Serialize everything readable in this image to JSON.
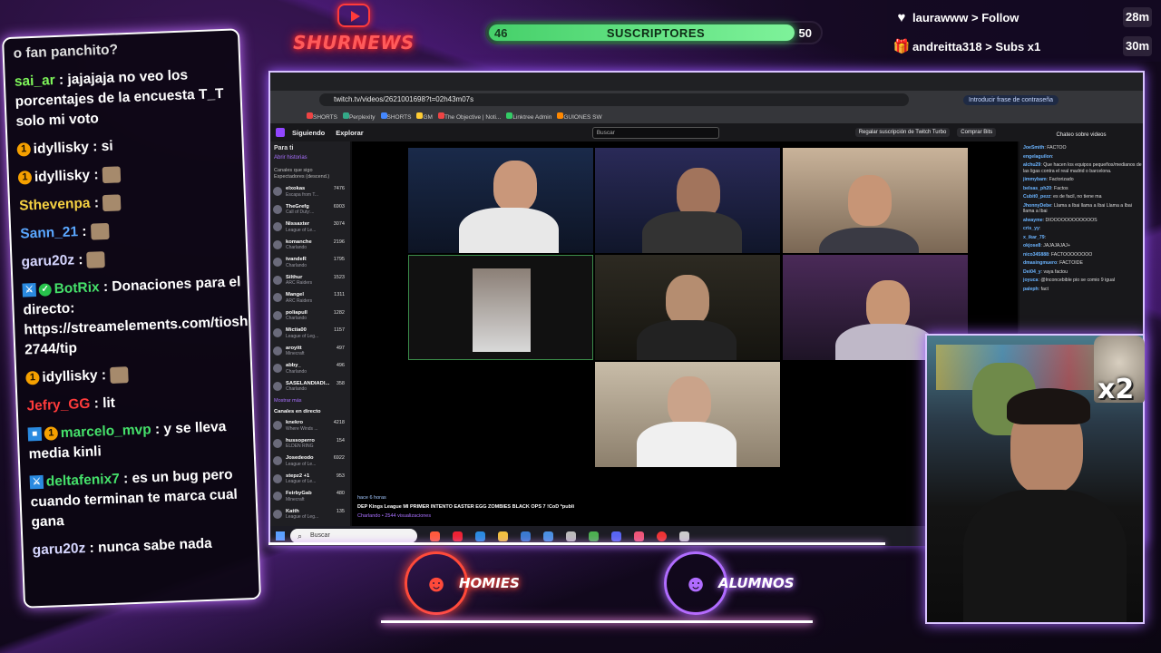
{
  "overlay": {
    "logo_text": "SHURNEWS",
    "subs": {
      "current": "46",
      "label": "SUSCRIPTORES",
      "goal": "50",
      "progress": 0.92
    },
    "alerts": [
      {
        "icon": "heart-icon",
        "text": "laurawww > Follow",
        "time": "28m"
      },
      {
        "icon": "gift-icon",
        "text": "andreitta318 > Subs x1",
        "time": "30m"
      }
    ],
    "teams": [
      {
        "name": "HOMIES",
        "color": "#ff4a3a"
      },
      {
        "name": "ALUMNOS",
        "color": "#b06cff"
      }
    ],
    "cam_badge": "x2"
  },
  "chat": {
    "top_text": "o fan panchito?",
    "messages": [
      {
        "user": "sai_ar",
        "color": "#7ef55a",
        "text": " : jajajaja no veo los porcentajes de la encuesta T_T solo mi voto",
        "badges": []
      },
      {
        "user": "idyllisky",
        "color": "#ffffff",
        "text": " : si",
        "badges": [
          "sub"
        ]
      },
      {
        "user": "idyllisky",
        "color": "#ffffff",
        "text": " : ",
        "badges": [
          "sub"
        ],
        "emote": true
      },
      {
        "user": "Sthevenpa",
        "color": "#f5d142",
        "text": " : ",
        "badges": [],
        "emote": true
      },
      {
        "user": "Sann_21",
        "color": "#5aa7ff",
        "text": " : ",
        "badges": [],
        "emote": true
      },
      {
        "user": "garu20z",
        "color": "#d6d6ff",
        "text": " : ",
        "badges": [],
        "emote": true
      },
      {
        "user": "BotRix",
        "color": "#45e06a",
        "text": " : Donaciones para el directo: https://streamelements.com/tioshur-2744/tip",
        "badges": [
          "mod",
          "verified"
        ]
      },
      {
        "user": "idyllisky",
        "color": "#ffffff",
        "text": " : ",
        "badges": [
          "sub"
        ],
        "emote": true
      },
      {
        "user": "Jefry_GG",
        "color": "#ff3b3b",
        "text": " : lit",
        "badges": []
      },
      {
        "user": "marcelo_mvp",
        "color": "#45e06a",
        "text": " : y se lleva media kinli",
        "badges": [
          "cube",
          "sub"
        ]
      },
      {
        "user": "deltafenix7",
        "color": "#45e06a",
        "text": " : es un bug pero cuando terminan te marca cual gana",
        "badges": [
          "mod"
        ]
      },
      {
        "user": "garu20z",
        "color": "#d6d6ff",
        "text": " : nunca sabe nada",
        "badges": []
      }
    ]
  },
  "browser": {
    "url": "twitch.tv/videos/2621001698?t=02h43m07s",
    "password_hint": "Introducir frase de contraseña",
    "bookmarks": [
      "SHORTS",
      "Perplexity",
      "SHORTS",
      "GM",
      "The Objective | Noti...",
      "Linktree Admin",
      "GUIONES SW"
    ],
    "twitch": {
      "nav": [
        "Siguiendo",
        "Explorar"
      ],
      "search_placeholder": "Buscar",
      "turbo": "Regalar suscripción de Twitch Turbo",
      "bits": "Comprar Bits",
      "sidebar_title": "Para ti",
      "open_history": "Abrir historias",
      "followed_title": "Canales que sigo",
      "followed_sub": "Espectadores (descend.)",
      "channels": [
        {
          "name": "elxokas",
          "game": "Escapa from T...",
          "viewers": "7476"
        },
        {
          "name": "TheGrefg",
          "game": "Call of Duty:...",
          "viewers": "6903"
        },
        {
          "name": "Nissaxter",
          "game": "League of Le...",
          "viewers": "3074"
        },
        {
          "name": "komanche",
          "game": "Charlando",
          "viewers": "2196"
        },
        {
          "name": "tvandeR",
          "game": "Charlando",
          "viewers": "1795"
        },
        {
          "name": "Silthur",
          "game": "ARC Raiders",
          "viewers": "1523"
        },
        {
          "name": "Mangel",
          "game": "ARC Raiders",
          "viewers": "1311"
        },
        {
          "name": "poliapull",
          "game": "Charlando",
          "viewers": "1282"
        },
        {
          "name": "Mictia00",
          "game": "League of Leg...",
          "viewers": "1157"
        },
        {
          "name": "aroyitt",
          "game": "Minecraft",
          "viewers": "497"
        },
        {
          "name": "abby_",
          "game": "Charlando",
          "viewers": "496"
        },
        {
          "name": "SASELANDIADI...",
          "game": "Charlando",
          "viewers": "358"
        }
      ],
      "show_more": "Mostrar más",
      "live_title": "Canales en directo",
      "live_channels": [
        {
          "name": "knekro",
          "game": "Where Winds ...",
          "viewers": "4218"
        },
        {
          "name": "hussoperro",
          "game": "ELDEN RING",
          "viewers": "154"
        },
        {
          "name": "Josedeodo",
          "game": "League of Le...",
          "viewers": "6922"
        },
        {
          "name": "stepz2 +1",
          "game": "League of Le...",
          "viewers": "953"
        },
        {
          "name": "FeirbyGab",
          "game": "Minecraft",
          "viewers": "480"
        },
        {
          "name": "Katth",
          "game": "League of Leg...",
          "viewers": "135"
        }
      ],
      "video_time": "hace 6 horas",
      "video_title": "DEP Kings League MI PRIMER INTENTO EASTER EGG ZOMBIES BLACK OPS 7 !CoD *publi",
      "video_meta": "Charlando • 2544 visualizaciones",
      "chat_header": "Chateo sobre videos",
      "chat_lines": [
        {
          "user": "JoeSmith",
          "text": "FACTOO"
        },
        {
          "user": "engelaguilon",
          "text": ""
        },
        {
          "user": "alchu29",
          "text": "Que hacen los equipos pequeños/medianos de las ligas contra el real madrid o barcelona."
        },
        {
          "user": "jimmybam",
          "text": "Factorizado"
        },
        {
          "user": "belsas_ph20",
          "text": "Factos"
        },
        {
          "user": "Cubit0_pezz",
          "text": "es de facil, no tiene ma"
        },
        {
          "user": "JhonnyDebe",
          "text": "Llama a Ibai llama a Ibai Llama a Ibai llama a Ibai"
        },
        {
          "user": "alwayme",
          "text": "DIOOOOOOOOOOOOS"
        },
        {
          "user": "cris_yy",
          "text": ""
        },
        {
          "user": "x_ikar_79",
          "text": ""
        },
        {
          "user": "okjose8",
          "text": "JAJAJAJAJ+"
        },
        {
          "user": "nico345888",
          "text": "FACTOOOOOOOO"
        },
        {
          "user": "dmasingmuero",
          "text": "FACTOIDE"
        },
        {
          "user": "Dei04_y",
          "text": "vaya factou"
        },
        {
          "user": "joyuca",
          "text": "@Inconcebible pio se comio 9 igual"
        },
        {
          "user": "paleph",
          "text": "fact"
        }
      ]
    },
    "taskbar_search": "Buscar"
  }
}
